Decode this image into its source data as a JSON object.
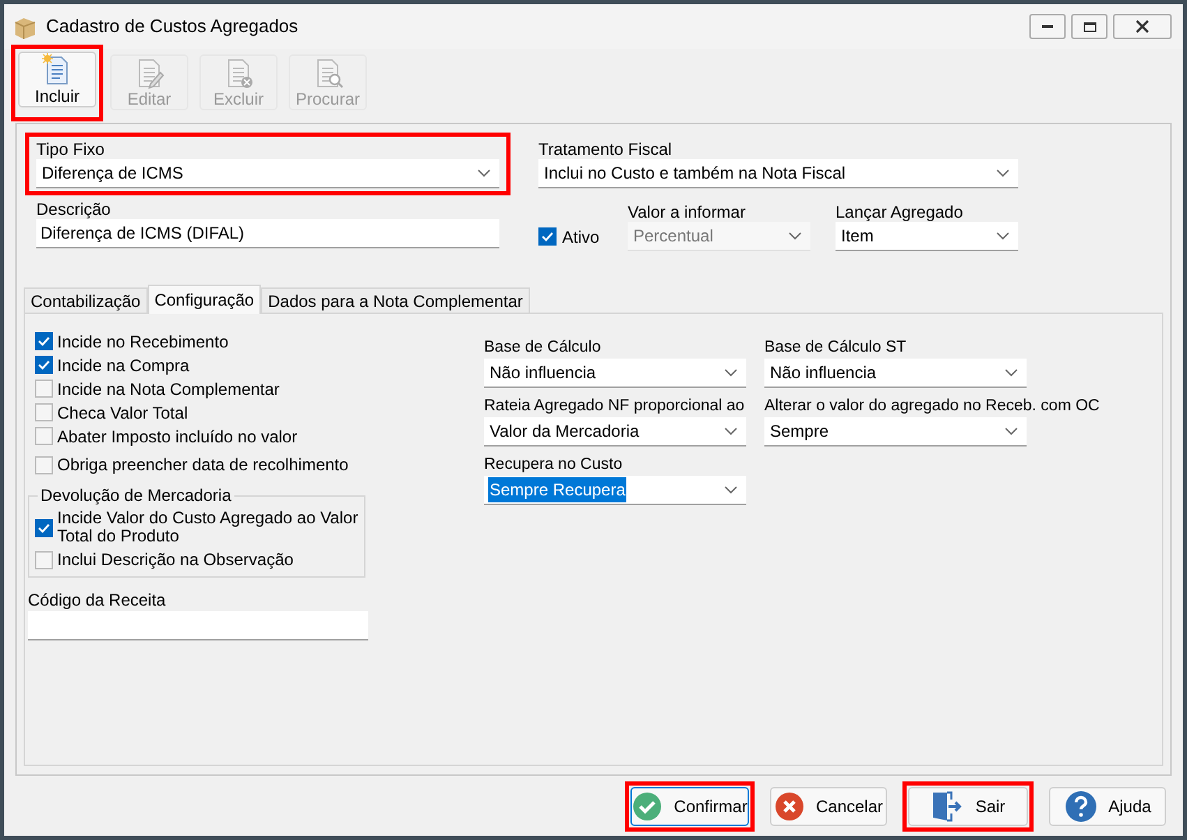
{
  "window": {
    "title": "Cadastro de Custos Agregados"
  },
  "toolbar": [
    {
      "label": "Incluir",
      "kind": "new",
      "disabled": false,
      "highlighted": true
    },
    {
      "label": "Editar",
      "kind": "edit",
      "disabled": true,
      "highlighted": false
    },
    {
      "label": "Excluir",
      "kind": "delete",
      "disabled": true,
      "highlighted": false
    },
    {
      "label": "Procurar",
      "kind": "search",
      "disabled": true,
      "highlighted": false
    }
  ],
  "header": {
    "tipo_fixo": {
      "label": "Tipo Fixo",
      "value": "Diferença de ICMS",
      "highlighted": true
    },
    "tratamento_fiscal": {
      "label": "Tratamento Fiscal",
      "value": "Inclui no Custo e também na Nota Fiscal"
    },
    "descricao": {
      "label": "Descrição",
      "value": "Diferença de ICMS (DIFAL)"
    },
    "ativo": {
      "label": "Ativo",
      "checked": true
    },
    "valor_a_informar": {
      "label": "Valor a informar",
      "value": "Percentual",
      "disabled": true
    },
    "lancar_agregado": {
      "label": "Lançar Agregado",
      "value": "Item"
    }
  },
  "tabs": [
    {
      "label": "Contabilização",
      "selected": false
    },
    {
      "label": "Configuração",
      "selected": true
    },
    {
      "label": "Dados para a Nota Complementar",
      "selected": false
    }
  ],
  "checkboxes": [
    {
      "label": "Incide no Recebimento",
      "checked": true
    },
    {
      "label": "Incide na Compra",
      "checked": true
    },
    {
      "label": "Incide na Nota Complementar",
      "checked": false
    },
    {
      "label": "Checa Valor Total",
      "checked": false
    },
    {
      "label": "Abater Imposto incluído no valor",
      "checked": false
    },
    {
      "label": "Obriga preencher data de recolhimento",
      "checked": false
    }
  ],
  "devolucao": {
    "title": "Devolução de Mercadoria",
    "items": [
      {
        "label": "Incide Valor do Custo Agregado ao Valor Total do Produto",
        "checked": true
      },
      {
        "label": "Inclui Descrição na Observação",
        "checked": false
      }
    ]
  },
  "codigo_receita": {
    "label": "Código da Receita"
  },
  "selects": [
    {
      "label": "Base de Cálculo",
      "value": "Não influencia",
      "text_selected": false
    },
    {
      "label": "Base de Cálculo ST",
      "value": "Não influencia",
      "text_selected": false
    },
    {
      "label": "Rateia Agregado NF proporcional ao",
      "value": "Valor da Mercadoria",
      "text_selected": false
    },
    {
      "label": "Alterar o valor do agregado no Receb. com OC",
      "value": "Sempre",
      "text_selected": false
    },
    {
      "label": "Recupera no Custo",
      "value": "Sempre Recupera",
      "text_selected": true
    }
  ],
  "buttons": [
    {
      "label": "Confirmar",
      "kind": "confirm",
      "highlighted": true,
      "focused": true
    },
    {
      "label": "Cancelar",
      "kind": "cancel",
      "highlighted": false,
      "focused": false
    },
    {
      "label": "Sair",
      "kind": "exit",
      "highlighted": true,
      "focused": false
    },
    {
      "label": "Ajuda",
      "kind": "help",
      "highlighted": false,
      "focused": false
    }
  ]
}
